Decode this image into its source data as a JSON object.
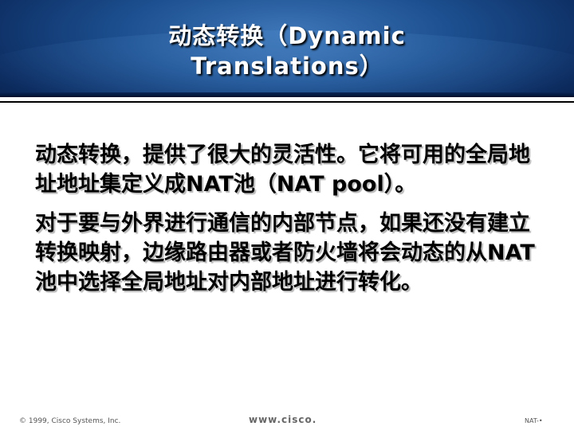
{
  "slide": {
    "title_line1": "动态转换（Dynamic",
    "title_line2": "Translations）",
    "paragraphs": [
      "动态转换，提供了很大的灵活性。它将可用的全局地址地址集定义成NAT池（NAT pool）。",
      "对于要与外界进行通信的内部节点，如果还没有建立转换映射，边缘路由器或者防火墙将会动态的从NAT池中选择全局地址对内部地址进行转化。"
    ]
  },
  "footer": {
    "copyright": "© 1999, Cisco Systems, Inc.",
    "url": "www.cisco.",
    "page": "NAT-•"
  },
  "colors": {
    "header_blue": "#1c4f8f",
    "title_text": "#ffffff",
    "body_text": "#000000"
  }
}
